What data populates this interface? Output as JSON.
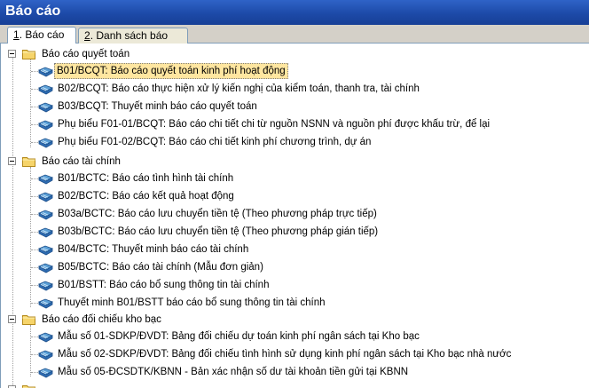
{
  "window": {
    "title": "Báo cáo"
  },
  "tabs": [
    {
      "num": "1",
      "label": ". Báo cáo"
    },
    {
      "num": "2",
      "label": ". Danh sách báo cáo"
    }
  ],
  "tree": {
    "group1": {
      "label": "Báo cáo quyết toán",
      "items": [
        "B01/BCQT: Báo cáo quyết toán kinh phí hoạt động",
        "B02/BCQT: Báo cáo thực hiện xử lý kiến nghị của kiểm toán, thanh tra, tài chính",
        "B03/BCQT: Thuyết minh báo cáo quyết toán",
        "Phụ biểu F01-01/BCQT: Báo cáo chi tiết chi từ nguồn NSNN và nguồn phí được khấu trừ, để lại",
        "Phụ biểu F01-02/BCQT: Báo cáo chi tiết kinh phí chương trình, dự án"
      ]
    },
    "group2": {
      "label": "Báo cáo tài chính",
      "items": [
        "B01/BCTC: Báo cáo tình hình tài chính",
        "B02/BCTC: Báo cáo kết quả hoạt động",
        "B03a/BCTC: Báo cáo lưu chuyển tiền tệ (Theo phương pháp trực tiếp)",
        "B03b/BCTC: Báo cáo lưu chuyển tiền tệ (Theo phương pháp gián tiếp)",
        "B04/BCTC: Thuyết minh báo cáo tài chính",
        "B05/BCTC: Báo cáo tài chính (Mẫu đơn giản)",
        "B01/BSTT: Báo cáo bổ sung thông tin tài chính",
        "Thuyết minh B01/BSTT báo cáo bổ sung thông tin tài chính"
      ]
    },
    "group3": {
      "label": "Báo cáo đối chiếu kho bạc",
      "items": [
        "Mẫu số 01-SDKP/ĐVDT: Bảng đối chiếu dự toán kinh phí ngân sách tại Kho bạc",
        "Mẫu số 02-SDKP/ĐVDT: Bảng đối chiếu tình hình sử dụng kinh phí ngân sách tại Kho bạc nhà nước",
        "Mẫu số 05-ĐCSDTK/KBNN - Bản xác nhận số dư tài khoản tiền gửi tại KBNN"
      ]
    }
  },
  "colors": {
    "title_bg": "#1d4aa8",
    "selection": "#ffe6a0"
  },
  "icons": {
    "group": "folder-icon",
    "report": "report-book-icon"
  }
}
